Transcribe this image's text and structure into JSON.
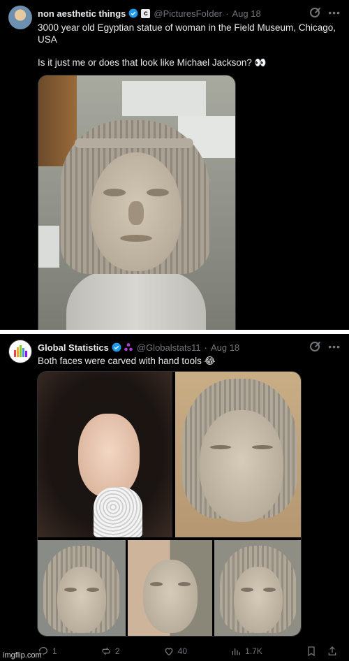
{
  "tweet1": {
    "author_name": "non aesthetic things",
    "handle": "@PicturesFoIder",
    "separator": "·",
    "date": "Aug 18",
    "badge_letter": "c",
    "text_line1": "3000 year old Egyptian statue of woman in the Field Museum, Chicago, USA",
    "text_line2": "Is it just me or does that look like Michael Jackson? 👀",
    "icons": {
      "verified": "verified-check-icon",
      "grok": "grok-icon",
      "more": "more-icon"
    },
    "colors": {
      "verified": "#1d9bf0"
    }
  },
  "tweet2": {
    "author_name": "Global Statistics",
    "handle": "@Globalstats11",
    "separator": "·",
    "date": "Aug 18",
    "text": "Both faces were carved with hand tools 😂",
    "actions": {
      "replies": "1",
      "reposts": "2",
      "likes": "40",
      "views": "1.7K"
    },
    "icons": {
      "verified": "verified-check-icon",
      "affiliate": "affiliate-icon",
      "grok": "grok-icon",
      "more": "more-icon"
    },
    "colors": {
      "verified": "#1d9bf0",
      "affiliate": "#a442c8"
    }
  },
  "watermark": "imgflip.com"
}
